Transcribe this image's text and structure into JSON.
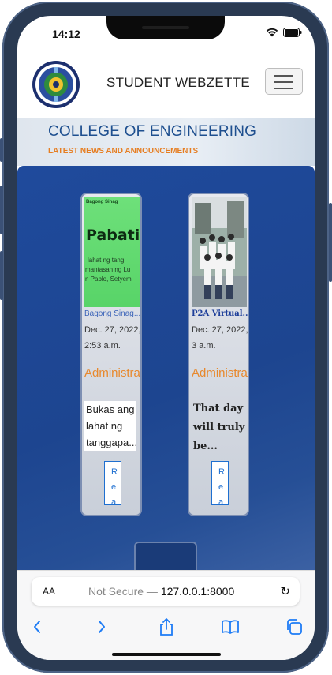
{
  "status_bar": {
    "time": "14:12"
  },
  "navbar": {
    "brand": "STUDENT WEBZETTE",
    "logo_text": "COLLEGE OF ENGINEERING"
  },
  "hero": {
    "title": "COLLEGE OF ENGINEERING",
    "subtitle": "LATEST NEWS AND ANNOUNCEMENTS"
  },
  "cards": [
    {
      "image_headline": "Pabatid!",
      "image_top": "Bagong Sinag",
      "image_lines": [
        "lahat ng tang",
        "mantasan ng Lu",
        "n Pablo, Setyem"
      ],
      "category": "Bagong Sinag...",
      "date": "Dec. 27, 2022, 2:53 a.m.",
      "author": "Administrator",
      "excerpt": "Bukas ang lahat ng tanggapa...",
      "read_more": "Read more"
    },
    {
      "category": "P2A Virtual...",
      "date": "Dec. 27, 2022, 3 a.m.",
      "author": "Administrator",
      "excerpt": "That day will truly be...",
      "read_more": "Read more"
    }
  ],
  "browser": {
    "aa_label": "AA",
    "security": "Not Secure —",
    "url": "127.0.0.1:8000"
  },
  "colors": {
    "accent_blue": "#1e4f8f",
    "accent_orange": "#e67e22",
    "main_bg": "#1f4a9c",
    "link_blue": "#1e6fd0"
  }
}
